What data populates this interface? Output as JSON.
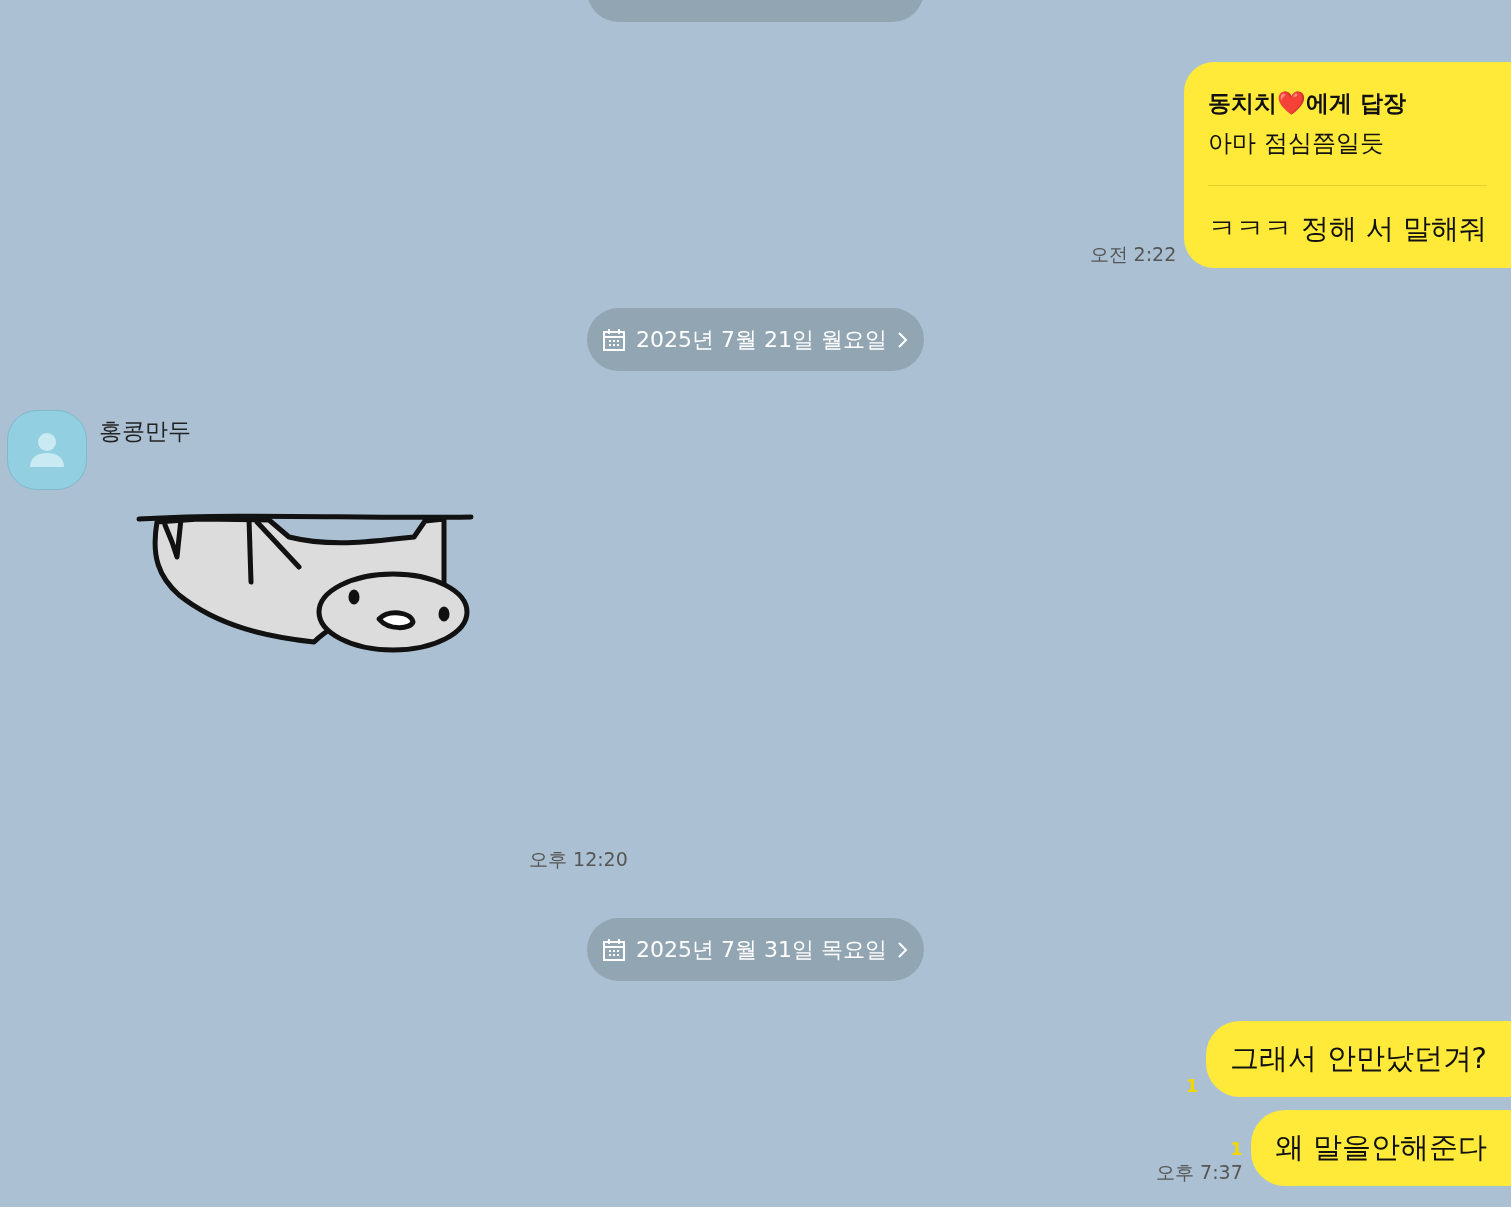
{
  "messages": [
    {
      "kind": "date"
    },
    {
      "kind": "reply",
      "reply_to": "동치치❤️에게 답장",
      "quoted": "아마 점심쯤일듯",
      "text": "ㅋㅋㅋ 정해 서 말해줘",
      "time": "오전 2:22"
    },
    {
      "kind": "date",
      "label": "2025년 7월 21일 월요일"
    },
    {
      "kind": "sticker",
      "sender": "홍콩만두",
      "time": "오후 12:20"
    },
    {
      "kind": "date",
      "label": "2025년 7월 31일 목요일"
    },
    {
      "kind": "text",
      "text": "그래서 안만났던겨?",
      "unread": "1"
    },
    {
      "kind": "text",
      "text": "왜 말을안해준다",
      "unread": "1",
      "time": "오후 7:37"
    }
  ]
}
